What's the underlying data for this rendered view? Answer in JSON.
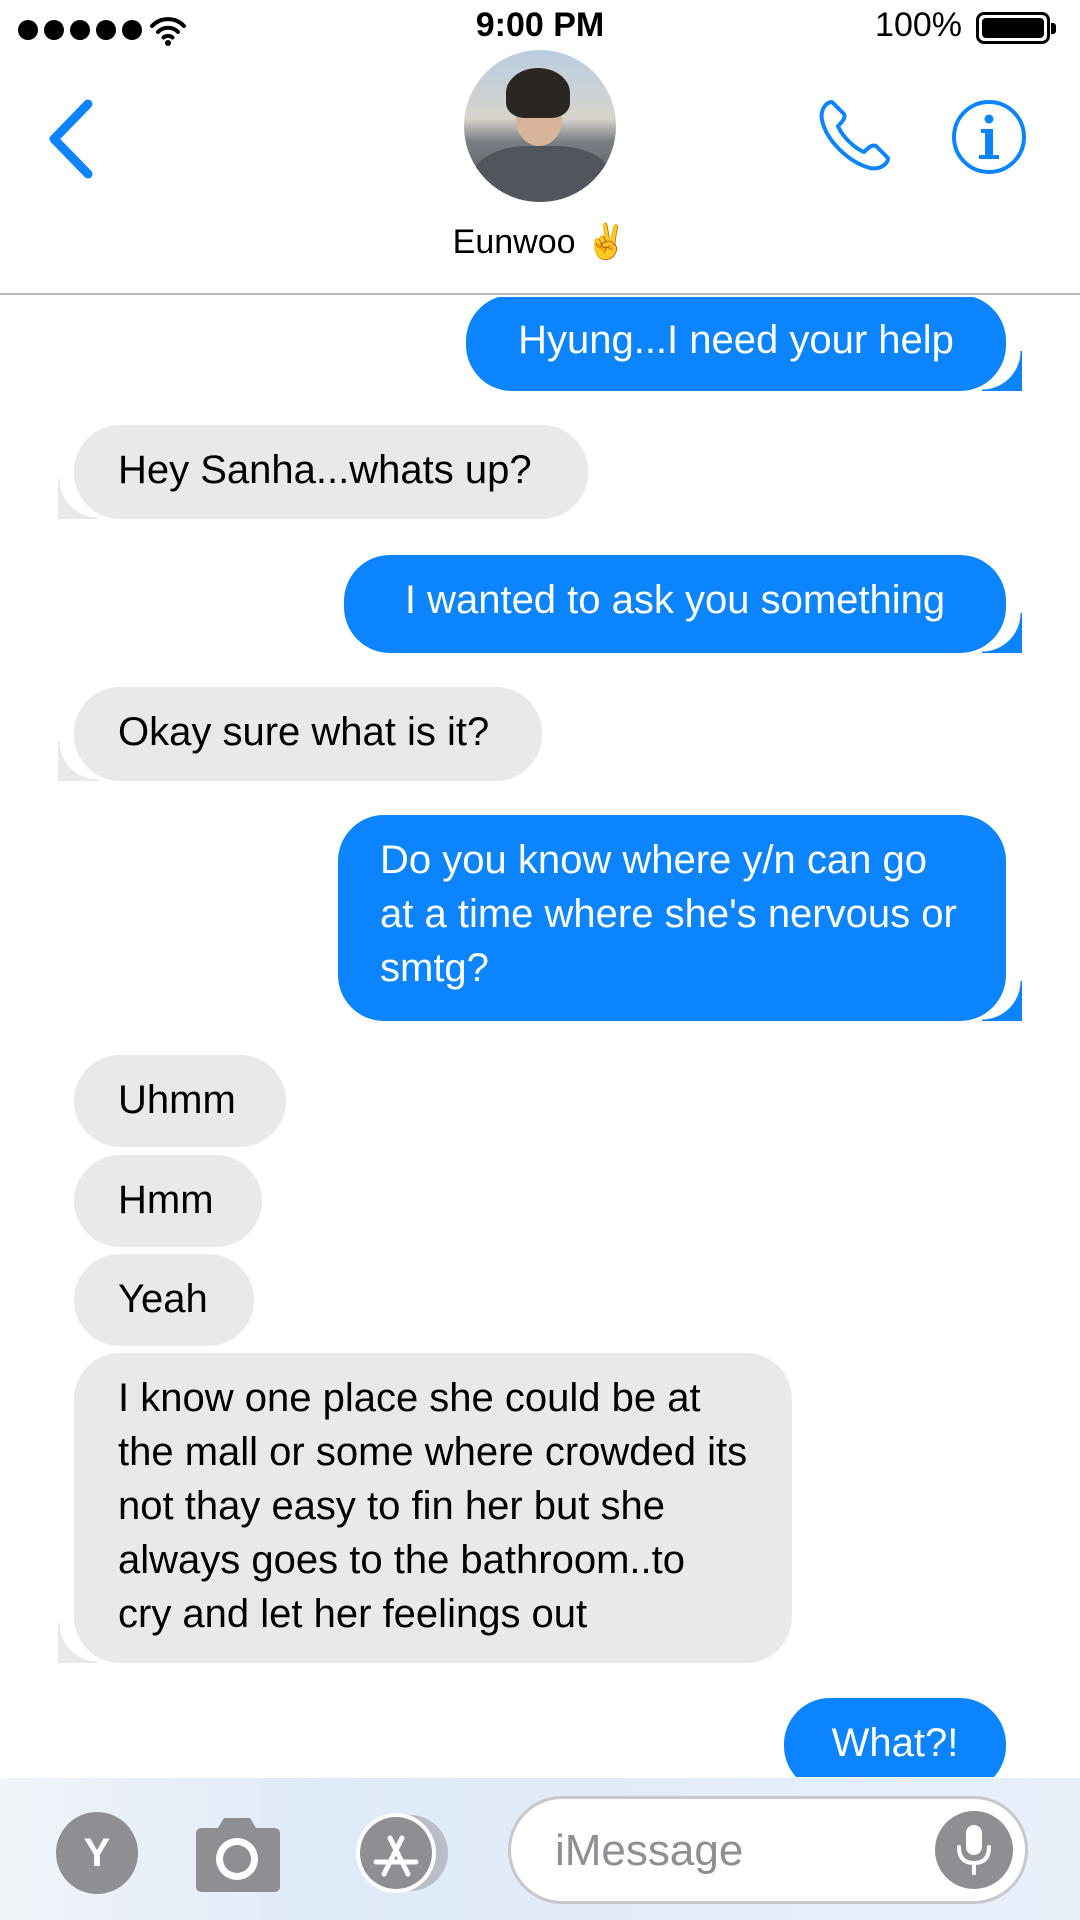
{
  "status_bar": {
    "time": "9:00 PM",
    "battery": "100%",
    "icons": [
      "signal-dots-icon",
      "wifi-icon",
      "battery-icon"
    ]
  },
  "header": {
    "contact_name": "Eunwoo ✌️",
    "icons": [
      "chevron-left-icon",
      "phone-icon",
      "info-icon"
    ],
    "accent_color": "#0b84fe"
  },
  "messages": [
    {
      "from": "me",
      "text": "Hyung...I need your help"
    },
    {
      "from": "them",
      "text": "Hey Sanha...whats up?"
    },
    {
      "from": "me",
      "text": "I wanted to ask you something"
    },
    {
      "from": "them",
      "text": "Okay sure what is it?"
    },
    {
      "from": "me",
      "text": "Do you know where y/n can go at a time where she's nervous or smtg?"
    },
    {
      "from": "them",
      "text": "Uhmm"
    },
    {
      "from": "them",
      "text": "Hmm"
    },
    {
      "from": "them",
      "text": "Yeah"
    },
    {
      "from": "them",
      "text": "I know one place she could be at the mall or some where crowded its not thay easy to fin her but she always goes to the bathroom..to cry and let her feelings out"
    },
    {
      "from": "me",
      "text": "What?!"
    }
  ],
  "input_bar": {
    "avatar_letter": "Y",
    "placeholder": "iMessage",
    "icons": [
      "camera-icon",
      "app-store-icon",
      "microphone-icon"
    ]
  },
  "colors": {
    "sent_bubble": "#0b84fe",
    "received_bubble": "#e9e9eb"
  }
}
